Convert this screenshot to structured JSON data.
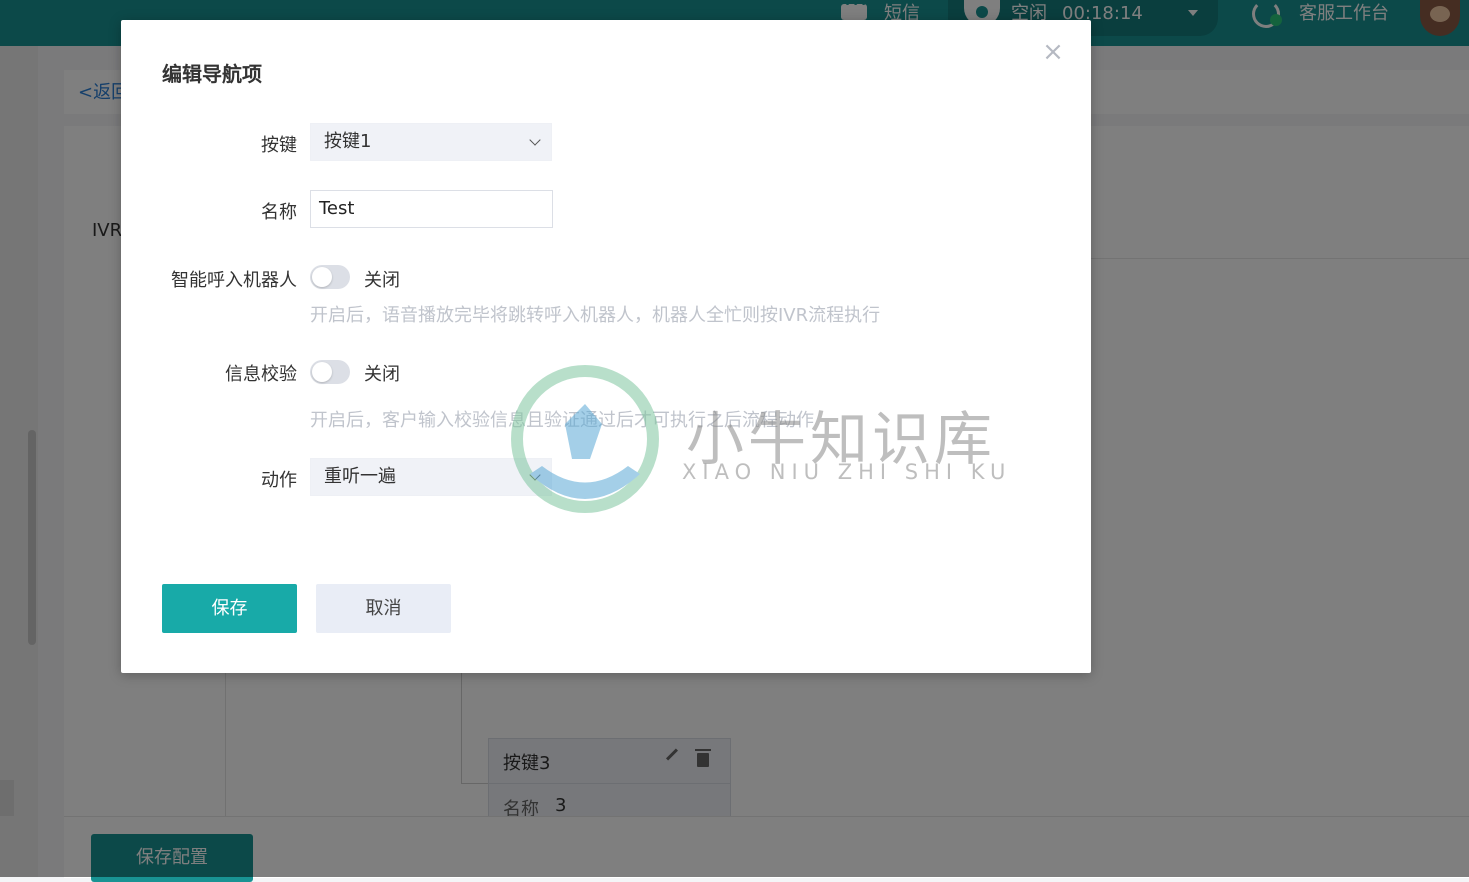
{
  "topbar": {
    "sms_label": "短信",
    "status_label": "空闲",
    "timer": "00:18:14",
    "workspace_label": "客服工作台"
  },
  "background": {
    "back_link": "<返回",
    "ivr_label": "IVR",
    "node": {
      "title": "按键3",
      "name_label": "名称",
      "name_value": "3"
    },
    "save_config_button": "保存配置"
  },
  "dialog": {
    "title": "编辑导航项",
    "key": {
      "label": "按键",
      "value": "按键1"
    },
    "name": {
      "label": "名称",
      "value": "Test"
    },
    "robot": {
      "label": "智能呼入机器人",
      "state": "关闭",
      "hint": "开启后，语音播放完毕将跳转呼入机器人，机器人全忙则按IVR流程执行"
    },
    "verify": {
      "label": "信息校验",
      "state": "关闭",
      "hint": "开启后，客户输入校验信息且验证通过后才可执行之后流程动作"
    },
    "action": {
      "label": "动作",
      "value": "重听一遍"
    },
    "save_button": "保存",
    "cancel_button": "取消"
  },
  "watermark": {
    "text": "小牛知识库",
    "subtext": "XIAO NIU ZHI SHI KU"
  },
  "colors": {
    "brand": "#199393",
    "primary_button": "#18aaa8",
    "hint": "#c0c4cc"
  }
}
